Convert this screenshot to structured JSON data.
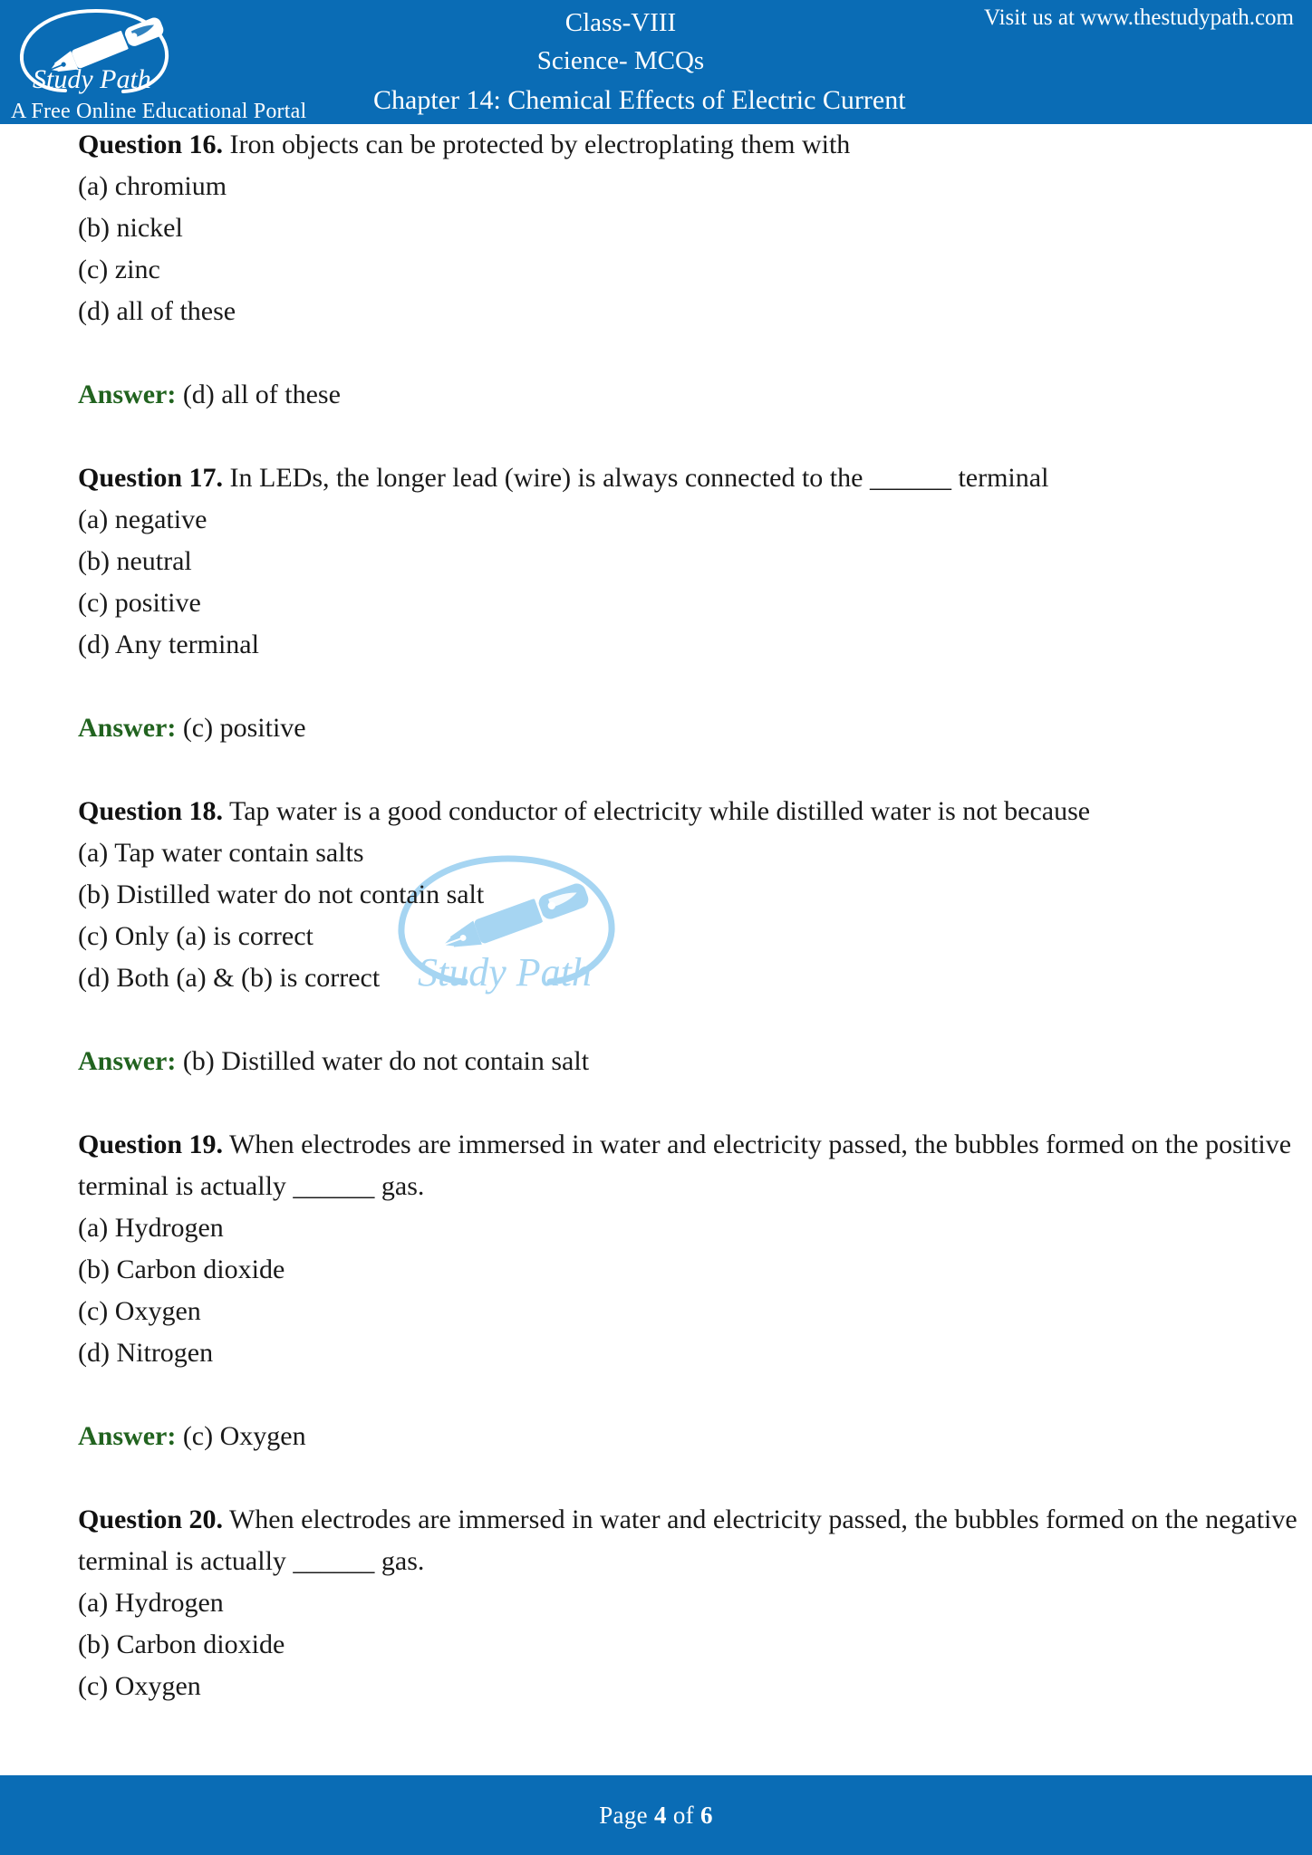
{
  "header": {
    "brand_name": "Study Path",
    "tagline": "A Free Online Educational Portal",
    "class_label": "Class-VIII",
    "subject_label": "Science- MCQs",
    "chapter_label": "Chapter 14: Chemical Effects of Electric Current",
    "visit_label": "Visit us at www.thestudypath.com",
    "logo_icon": "pen-in-oval-logo-icon",
    "bg_color": "#0a6cb5",
    "text_color": "#ffffff"
  },
  "watermark": {
    "brand_name": "Study Path",
    "icon": "pen-in-oval-watermark-icon",
    "color": "#a6d5f2"
  },
  "colors": {
    "accent_blue": "#0a6cb5",
    "answer_green": "#21631f",
    "body_text": "#1a1a1a"
  },
  "questions": [
    {
      "number_label": "Question 16.",
      "prompt": " Iron objects can be protected by electroplating them with",
      "options": [
        "(a) chromium",
        "(b) nickel",
        "(c) zinc",
        "(d) all of these"
      ],
      "answer_label": "Answer:",
      "answer_text": " (d) all of these"
    },
    {
      "number_label": "Question 17.",
      "prompt": " In LEDs, the longer lead (wire) is always connected to the ______ terminal",
      "options": [
        "(a) negative",
        "(b) neutral",
        "(c) positive",
        "(d) Any terminal"
      ],
      "answer_label": "Answer:",
      "answer_text": " (c) positive"
    },
    {
      "number_label": "Question 18.",
      "prompt": " Tap water is a good conductor of electricity while distilled water is not because",
      "options": [
        "(a) Tap water contain salts",
        "(b) Distilled water do not contain salt",
        "(c) Only (a) is correct",
        "(d) Both (a) & (b) is correct"
      ],
      "answer_label": "Answer:",
      "answer_text": " (b) Distilled water do not contain salt"
    },
    {
      "number_label": "Question 19.",
      "prompt": " When electrodes are immersed in water and electricity passed, the bubbles formed on the positive terminal is actually ______ gas.",
      "options": [
        "(a) Hydrogen",
        "(b) Carbon dioxide",
        "(c) Oxygen",
        "(d) Nitrogen"
      ],
      "answer_label": "Answer:",
      "answer_text": " (c) Oxygen"
    },
    {
      "number_label": "Question 20.",
      "prompt": " When electrodes are immersed in water and electricity passed, the bubbles formed on the negative terminal is actually ______ gas.",
      "options": [
        "(a) Hydrogen",
        "(b) Carbon dioxide",
        "(c) Oxygen"
      ],
      "answer_label": "",
      "answer_text": ""
    }
  ],
  "footer": {
    "page_prefix": "Page ",
    "page_number": "4",
    "page_middle": " of ",
    "page_total": "6"
  }
}
